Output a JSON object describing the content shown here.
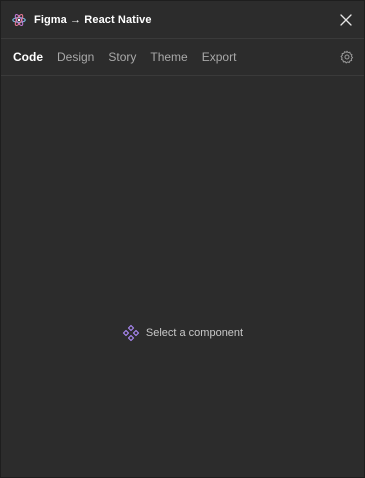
{
  "window": {
    "title": "Figma → React Native",
    "app_icon": "react-atom-icon",
    "close_icon": "close-icon"
  },
  "tabs": [
    {
      "label": "Code",
      "active": true
    },
    {
      "label": "Design",
      "active": false
    },
    {
      "label": "Story",
      "active": false
    },
    {
      "label": "Theme",
      "active": false
    },
    {
      "label": "Export",
      "active": false
    }
  ],
  "settings_icon": "gear-icon",
  "empty_state": {
    "icon": "component-icon",
    "message": "Select a component"
  },
  "colors": {
    "background": "#2c2c2c",
    "accent": "#a886f0"
  }
}
